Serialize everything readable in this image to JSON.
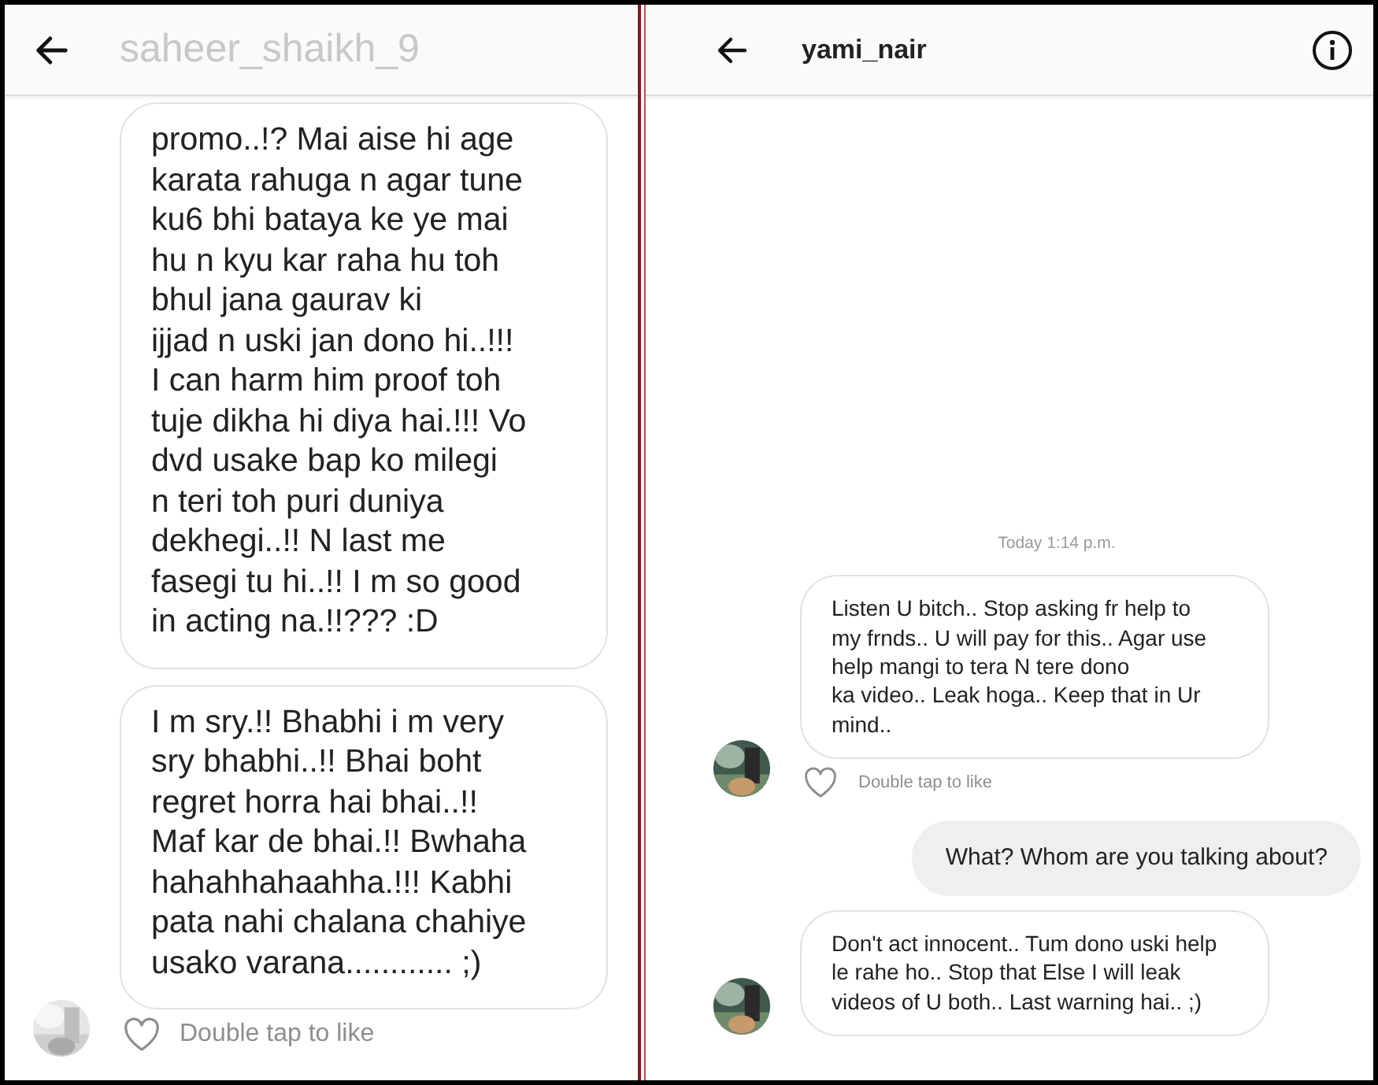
{
  "panels": [
    {
      "header": {
        "username": "saheer_shaikh_9",
        "info_button": false
      },
      "messages": [
        {
          "kind": "received",
          "avatar": false,
          "lines": [
            "promo..!? Mai aise hi age",
            "karata rahuga n agar tune",
            "ku6 bhi bataya ke ye mai",
            "hu n kyu kar raha hu toh",
            "bhul jana gaurav ki",
            "ijjad n uski jan dono hi..!!!",
            "I can harm him proof toh",
            "tuje dikha hi diya hai.!!! Vo",
            "dvd usake bap ko milegi",
            "n teri toh puri duniya",
            "dekhegi..!! N last me",
            "fasegi tu hi..!! I m so good",
            "in acting na.!!??? :D"
          ]
        },
        {
          "kind": "received",
          "avatar": true,
          "like_hint": "Double tap to like",
          "lines": [
            "I m sry.!! Bhabhi i m very",
            "sry bhabhi..!! Bhai boht",
            "regret horra hai bhai..!!",
            "Maf kar de bhai.!! Bwhaha",
            "hahahhahaahha.!!! Kabhi",
            "pata nahi chalana chahiye",
            "usako varana............ ;)"
          ]
        }
      ]
    },
    {
      "header": {
        "username": "yami_nair",
        "info_button": true
      },
      "messages": [
        {
          "kind": "timestamp",
          "text": "Today 1:14 p.m."
        },
        {
          "kind": "received",
          "avatar": true,
          "like_hint": "Double tap to like",
          "lines": [
            "Listen U bitch.. Stop asking fr help to",
            "my frnds.. U will pay for this.. Agar use",
            "help mangi to tera N tere dono",
            "ka video.. Leak hoga.. Keep that in Ur",
            "mind.."
          ]
        },
        {
          "kind": "sent",
          "lines": [
            "What? Whom are you talking about?"
          ]
        },
        {
          "kind": "received",
          "avatar": true,
          "lines": [
            "Don't act innocent.. Tum dono uski help",
            "le rahe ho.. Stop that Else I will leak",
            "videos of U both.. Last warning hai.. ;)"
          ]
        }
      ]
    }
  ]
}
